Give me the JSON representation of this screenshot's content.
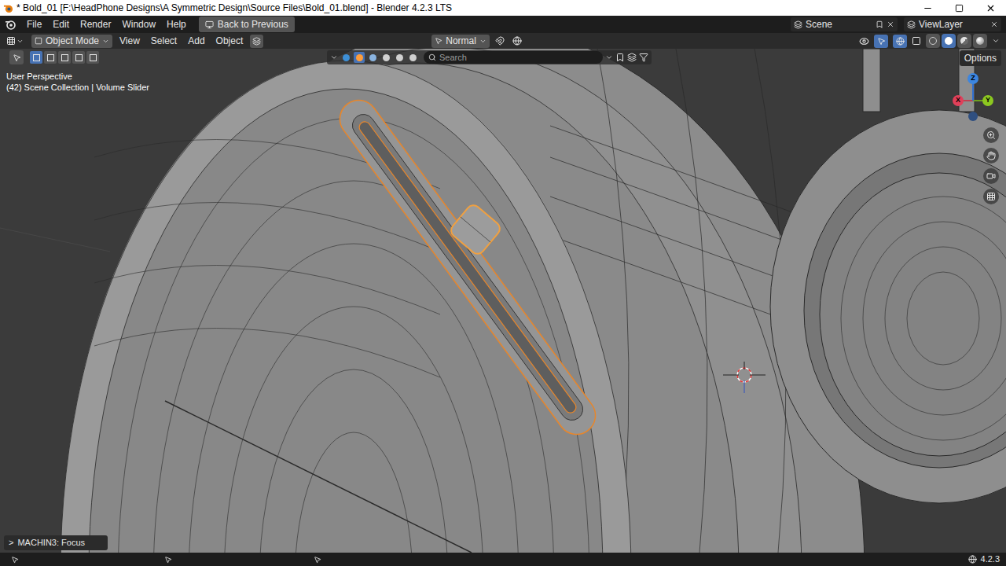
{
  "window": {
    "title": "* Bold_01 [F:\\HeadPhone Designs\\A Symmetric Design\\Source Files\\Bold_01.blend] - Blender 4.2.3 LTS"
  },
  "menu": [
    "File",
    "Edit",
    "Render",
    "Window",
    "Help"
  ],
  "back_button": "Back to Previous",
  "scene": "Scene",
  "view_layer": "ViewLayer",
  "header": {
    "mode": "Object Mode",
    "menus": [
      "View",
      "Select",
      "Add",
      "Object"
    ],
    "orientation": "Normal",
    "options": "Options"
  },
  "select_modes": [
    {
      "selected": true
    },
    {
      "selected": false
    },
    {
      "selected": false
    },
    {
      "selected": false
    },
    {
      "selected": false
    }
  ],
  "tool_settings": {
    "search_placeholder": "Search"
  },
  "shading": [
    {
      "kind": "wireframe",
      "selected": false
    },
    {
      "kind": "solid",
      "selected": true
    },
    {
      "kind": "material",
      "selected": false
    },
    {
      "kind": "rendered",
      "selected": false
    }
  ],
  "viewport": {
    "view_name": "User Perspective",
    "collection": "(42) Scene Collection | Volume Slider"
  },
  "gizmo": {
    "axes": [
      "X",
      "Y",
      "Z"
    ]
  },
  "last_operator": {
    "toggle": ">",
    "label": "MACHIN3: Focus",
    "expanded": false
  },
  "status_bar": {
    "version": "4.2.3"
  }
}
